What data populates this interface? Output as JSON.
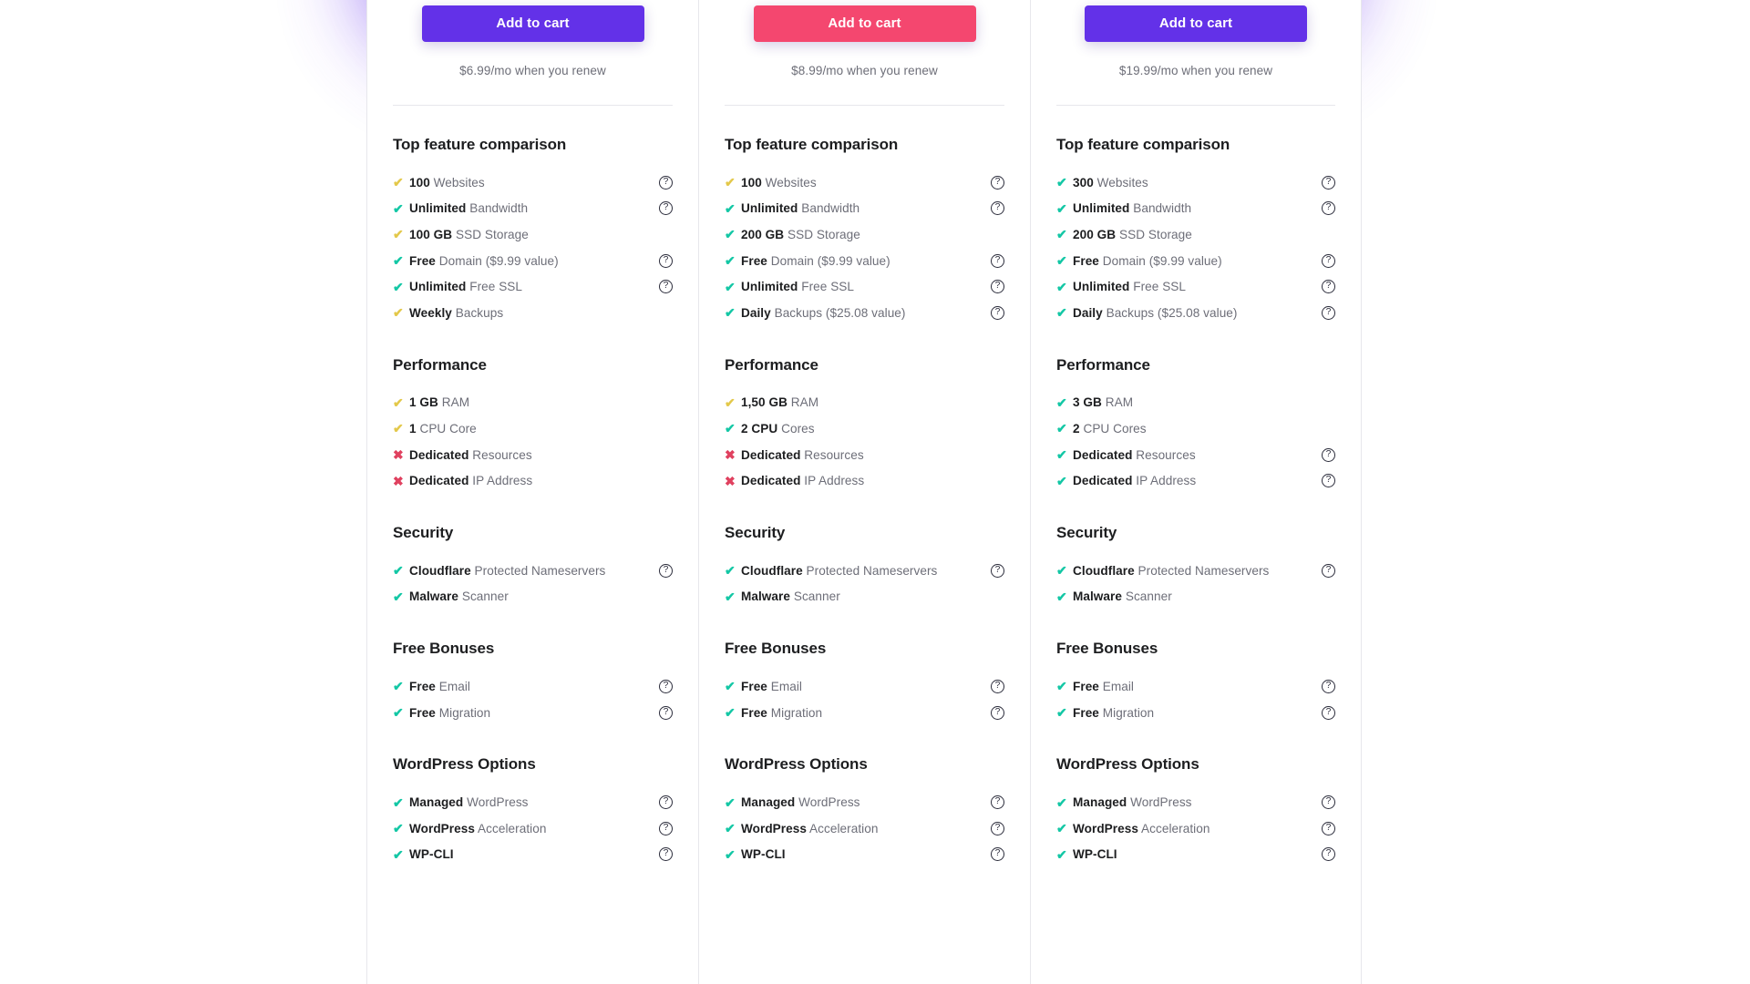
{
  "theme": {
    "violet": "#6331e8",
    "pink": "#f4476f",
    "check_teal": "#13c7a5",
    "check_gold": "#e3c84a",
    "cross_red": "#e0415f",
    "text_dark": "#1d1e20",
    "text_muted": "#6d6e78",
    "divider": "#e7e7ec"
  },
  "icons": {
    "check": "✔",
    "cross": "✖",
    "help": "?"
  },
  "plans": [
    {
      "id": "plan-1",
      "cta_label": "Add to cart",
      "cta_color": "violet",
      "renew_note": "$6.99/mo when you renew",
      "groups": [
        {
          "title": "Top feature comparison",
          "features": [
            {
              "mark": "check-gold",
              "strong": "100",
              "rest": " Websites",
              "help": true
            },
            {
              "mark": "check-teal",
              "strong": "Unlimited",
              "rest": " Bandwidth",
              "help": true
            },
            {
              "mark": "check-gold",
              "strong": "100 GB",
              "rest": " SSD Storage",
              "help": false
            },
            {
              "mark": "check-teal",
              "strong": "Free",
              "rest": " Domain ($9.99 value)",
              "help": true
            },
            {
              "mark": "check-teal",
              "strong": "Unlimited",
              "rest": " Free SSL",
              "help": true
            },
            {
              "mark": "check-gold",
              "strong": "Weekly",
              "rest": " Backups",
              "help": false
            }
          ]
        },
        {
          "title": "Performance",
          "features": [
            {
              "mark": "check-gold",
              "strong": "1 GB",
              "rest": " RAM",
              "help": false
            },
            {
              "mark": "check-gold",
              "strong": "1",
              "rest": " CPU Core",
              "help": false
            },
            {
              "mark": "cross-red",
              "strong": "Dedicated",
              "rest": " Resources",
              "help": false
            },
            {
              "mark": "cross-red",
              "strong": "Dedicated",
              "rest": " IP Address",
              "help": false
            }
          ]
        },
        {
          "title": "Security",
          "features": [
            {
              "mark": "check-teal",
              "strong": "Cloudflare",
              "rest": " Protected Nameservers",
              "help": true
            },
            {
              "mark": "check-teal",
              "strong": "Malware",
              "rest": " Scanner",
              "help": false
            }
          ]
        },
        {
          "title": "Free Bonuses",
          "features": [
            {
              "mark": "check-teal",
              "strong": "Free",
              "rest": " Email",
              "help": true
            },
            {
              "mark": "check-teal",
              "strong": "Free",
              "rest": " Migration",
              "help": true
            }
          ]
        },
        {
          "title": "WordPress Options",
          "features": [
            {
              "mark": "check-teal",
              "strong": "Managed",
              "rest": " WordPress",
              "help": true
            },
            {
              "mark": "check-teal",
              "strong": "WordPress",
              "rest": " Acceleration",
              "help": true
            },
            {
              "mark": "check-teal",
              "strong": "WP-CLI",
              "rest": "",
              "help": true
            }
          ]
        }
      ]
    },
    {
      "id": "plan-2",
      "cta_label": "Add to cart",
      "cta_color": "pink",
      "renew_note": "$8.99/mo when you renew",
      "groups": [
        {
          "title": "Top feature comparison",
          "features": [
            {
              "mark": "check-gold",
              "strong": "100",
              "rest": " Websites",
              "help": true
            },
            {
              "mark": "check-teal",
              "strong": "Unlimited",
              "rest": " Bandwidth",
              "help": true
            },
            {
              "mark": "check-teal",
              "strong": "200 GB",
              "rest": " SSD Storage",
              "help": false
            },
            {
              "mark": "check-teal",
              "strong": "Free",
              "rest": " Domain ($9.99 value)",
              "help": true
            },
            {
              "mark": "check-teal",
              "strong": "Unlimited",
              "rest": " Free SSL",
              "help": true
            },
            {
              "mark": "check-teal",
              "strong": "Daily",
              "rest": " Backups ($25.08 value)",
              "help": true
            }
          ]
        },
        {
          "title": "Performance",
          "features": [
            {
              "mark": "check-gold",
              "strong": "1,50 GB",
              "rest": " RAM",
              "help": false
            },
            {
              "mark": "check-teal",
              "strong": "2 CPU",
              "rest": " Cores",
              "help": false
            },
            {
              "mark": "cross-red",
              "strong": "Dedicated",
              "rest": " Resources",
              "help": false
            },
            {
              "mark": "cross-red",
              "strong": "Dedicated",
              "rest": " IP Address",
              "help": false
            }
          ]
        },
        {
          "title": "Security",
          "features": [
            {
              "mark": "check-teal",
              "strong": "Cloudflare",
              "rest": " Protected Nameservers",
              "help": true
            },
            {
              "mark": "check-teal",
              "strong": "Malware",
              "rest": " Scanner",
              "help": false
            }
          ]
        },
        {
          "title": "Free Bonuses",
          "features": [
            {
              "mark": "check-teal",
              "strong": "Free",
              "rest": " Email",
              "help": true
            },
            {
              "mark": "check-teal",
              "strong": "Free",
              "rest": " Migration",
              "help": true
            }
          ]
        },
        {
          "title": "WordPress Options",
          "features": [
            {
              "mark": "check-teal",
              "strong": "Managed",
              "rest": " WordPress",
              "help": true
            },
            {
              "mark": "check-teal",
              "strong": "WordPress",
              "rest": " Acceleration",
              "help": true
            },
            {
              "mark": "check-teal",
              "strong": "WP-CLI",
              "rest": "",
              "help": true
            }
          ]
        }
      ]
    },
    {
      "id": "plan-3",
      "cta_label": "Add to cart",
      "cta_color": "violet",
      "renew_note": "$19.99/mo when you renew",
      "groups": [
        {
          "title": "Top feature comparison",
          "features": [
            {
              "mark": "check-teal",
              "strong": "300",
              "rest": " Websites",
              "help": true
            },
            {
              "mark": "check-teal",
              "strong": "Unlimited",
              "rest": " Bandwidth",
              "help": true
            },
            {
              "mark": "check-teal",
              "strong": "200 GB",
              "rest": " SSD Storage",
              "help": false
            },
            {
              "mark": "check-teal",
              "strong": "Free",
              "rest": " Domain ($9.99 value)",
              "help": true
            },
            {
              "mark": "check-teal",
              "strong": "Unlimited",
              "rest": " Free SSL",
              "help": true
            },
            {
              "mark": "check-teal",
              "strong": "Daily",
              "rest": " Backups ($25.08 value)",
              "help": true
            }
          ]
        },
        {
          "title": "Performance",
          "features": [
            {
              "mark": "check-teal",
              "strong": "3 GB",
              "rest": " RAM",
              "help": false
            },
            {
              "mark": "check-teal",
              "strong": "2",
              "rest": " CPU Cores",
              "help": false
            },
            {
              "mark": "check-teal",
              "strong": "Dedicated",
              "rest": " Resources",
              "help": true
            },
            {
              "mark": "check-teal",
              "strong": "Dedicated",
              "rest": " IP Address",
              "help": true
            }
          ]
        },
        {
          "title": "Security",
          "features": [
            {
              "mark": "check-teal",
              "strong": "Cloudflare",
              "rest": " Protected Nameservers",
              "help": true
            },
            {
              "mark": "check-teal",
              "strong": "Malware",
              "rest": " Scanner",
              "help": false
            }
          ]
        },
        {
          "title": "Free Bonuses",
          "features": [
            {
              "mark": "check-teal",
              "strong": "Free",
              "rest": " Email",
              "help": true
            },
            {
              "mark": "check-teal",
              "strong": "Free",
              "rest": " Migration",
              "help": true
            }
          ]
        },
        {
          "title": "WordPress Options",
          "features": [
            {
              "mark": "check-teal",
              "strong": "Managed",
              "rest": " WordPress",
              "help": true
            },
            {
              "mark": "check-teal",
              "strong": "WordPress",
              "rest": " Acceleration",
              "help": true
            },
            {
              "mark": "check-teal",
              "strong": "WP-CLI",
              "rest": "",
              "help": true
            }
          ]
        }
      ]
    }
  ]
}
